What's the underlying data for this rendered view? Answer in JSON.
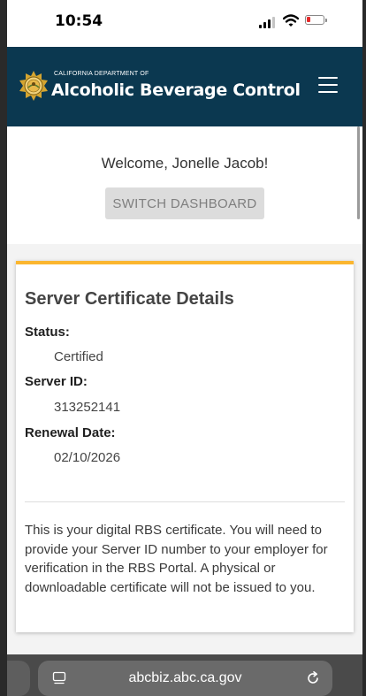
{
  "status_bar": {
    "time": "10:54"
  },
  "header": {
    "subtitle": "CALIFORNIA DEPARTMENT OF",
    "title": "Alcoholic Beverage Control"
  },
  "welcome": {
    "text": "Welcome, Jonelle Jacob!",
    "switch_label": "SWITCH DASHBOARD"
  },
  "card": {
    "title": "Server Certificate Details",
    "status_label": "Status:",
    "status_value": "Certified",
    "server_id_label": "Server ID:",
    "server_id_value": "313252141",
    "renewal_label": "Renewal Date:",
    "renewal_value": "02/10/2026",
    "description": "This is your digital RBS certificate. You will need to provide your Server ID number to your employer for verification in the RBS Portal. A physical or downloadable certificate will not be issued to you."
  },
  "browser": {
    "url": "abcbiz.abc.ca.gov"
  },
  "colors": {
    "header_bg": "#0b3850",
    "card_accent": "#fbb62f",
    "battery_low": "#e52b2b"
  },
  "icons": [
    "signal-icon",
    "wifi-icon",
    "battery-icon",
    "state-seal-icon",
    "hamburger-menu-icon",
    "reader-mode-icon",
    "reload-icon"
  ]
}
